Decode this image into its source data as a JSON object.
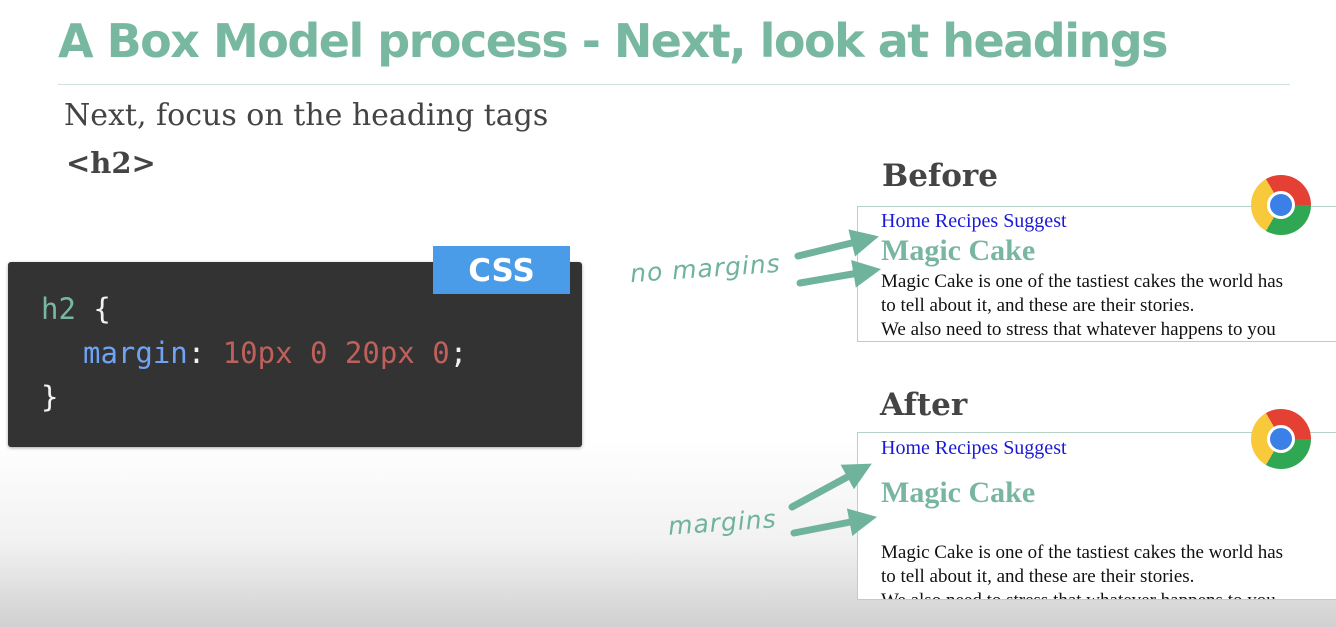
{
  "slide": {
    "title": "A Box Model process - Next, look at headings",
    "intro": "Next, focus on the heading tags",
    "tag": "<h2>"
  },
  "code": {
    "badge": "CSS",
    "selector": "h2",
    "open_brace": "{",
    "property": "margin",
    "colon": ":",
    "value": "10px 0 20px 0",
    "semicolon": ";",
    "close_brace": "}"
  },
  "before": {
    "heading": "Before",
    "nav": "Home Recipes Suggest",
    "h2": "Magic Cake",
    "paragraph_lines": [
      "Magic Cake is one of the tastiest cakes the world has",
      "to tell about it, and these are their stories.",
      "We also need to stress that whatever happens to you"
    ],
    "annotation": "no margins"
  },
  "after": {
    "heading": "After",
    "nav": "Home Recipes Suggest",
    "h2": "Magic Cake",
    "paragraph_lines": [
      "Magic Cake is one of the tastiest cakes the world has",
      "to tell about it, and these are their stories.",
      "We also need to stress that whatever happens to you"
    ],
    "annotation": "margins"
  },
  "icons": [
    "chrome-icon",
    "arrow-icon"
  ],
  "colors": {
    "accent_green": "#78b8a1",
    "code_bg": "#333333",
    "badge_blue": "#4a9be8",
    "code_property": "#6fa3f4",
    "code_value": "#c0605a",
    "link_blue": "#1a1ad6"
  }
}
